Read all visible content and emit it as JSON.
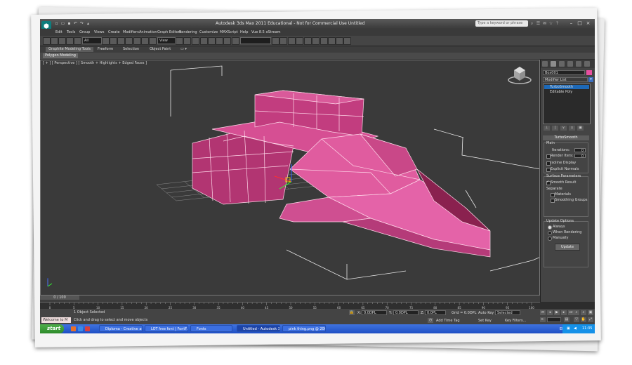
{
  "titlebar": {
    "title": "Autodesk 3ds Max  2011   Educational - Not for Commercial Use     Untitled",
    "search_placeholder": "Type a keyword or phrase"
  },
  "menu": [
    "Edit",
    "Tools",
    "Group",
    "Views",
    "Create",
    "Modifiers",
    "Animation",
    "Graph Editors",
    "Rendering",
    "Customize",
    "MAXScript",
    "Help",
    "Vue 8.5 xStream"
  ],
  "toolbar": {
    "selection_filter": "All",
    "ref_coord": "View"
  },
  "ribbon": {
    "tabs": [
      "Graphite Modeling Tools",
      "Freeform",
      "Selection",
      "Object Paint"
    ],
    "active_tab": "Graphite Modeling Tools",
    "sub_label": "Polygon Modeling"
  },
  "viewport": {
    "label": "[ + ] [ Perspective ] [ Smooth + Highlights + Edged Faces ]"
  },
  "command_panel": {
    "object_name": "Box001",
    "object_color": "#e84fa0",
    "modifier_list_label": "Modifier List",
    "stack": [
      {
        "label": "TurboSmooth",
        "selected": true
      },
      {
        "label": "Editable Poly",
        "selected": false
      }
    ],
    "rollout_title": "TurboSmooth",
    "main_label": "Main",
    "iterations_label": "Iterations:",
    "iterations_value": "0",
    "render_iters_label": "Render Iters:",
    "render_iters_value": "0",
    "isoline_display": "Isoline Display",
    "explicit_normals": "Explicit Normals",
    "surface_params_label": "Surface Parameters",
    "smooth_result": "Smooth Result",
    "separate_label": "Separate",
    "materials": "Materials",
    "smoothing_groups": "Smoothing Groups",
    "update_options_label": "Update Options",
    "always": "Always",
    "when_rendering": "When Rendering",
    "manually": "Manually",
    "update_button": "Update"
  },
  "timeline": {
    "slider": "0 / 100",
    "ticks": [
      "0",
      "5",
      "10",
      "15",
      "20",
      "25",
      "30",
      "35",
      "40",
      "45",
      "50",
      "55",
      "60",
      "65",
      "70",
      "75",
      "80",
      "85",
      "90",
      "95",
      "100"
    ]
  },
  "status": {
    "maxscript_label": "Welcome to M",
    "objects_selected": "1 Object Selected",
    "prompt": "Click and drag to select and move objects",
    "x_label": "X:",
    "x_value": "0.0DPL",
    "y_label": "Y:",
    "y_value": "0.0DPL",
    "z_label": "Z:",
    "z_value": "0.0PL",
    "grid": "Grid = 0.0DPL",
    "add_time_tag": "Add Time Tag",
    "auto_key": "Auto Key",
    "set_key": "Set Key",
    "selected_dropdown": "Selected",
    "key_filters": "Key Filters..."
  },
  "taskbar": {
    "start_label": "start",
    "tasks": [
      {
        "label": "Diploma - Creative an...",
        "active": false
      },
      {
        "label": "LOT free font | FontF...",
        "active": false
      },
      {
        "label": "Fonts",
        "active": false
      },
      {
        "label": "Untitled - Autodesk 3...",
        "active": true
      },
      {
        "label": "pink thing.png @ 200...",
        "active": false
      }
    ],
    "language": "EN",
    "clock": "11:35"
  }
}
